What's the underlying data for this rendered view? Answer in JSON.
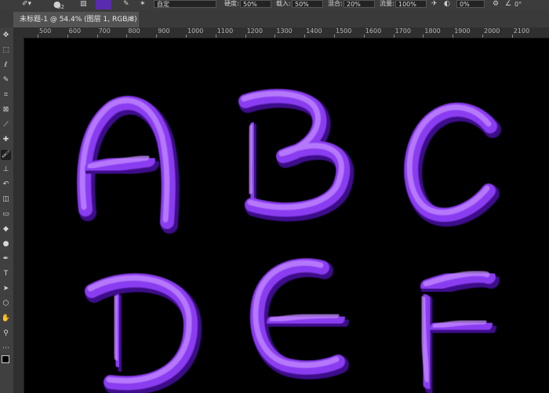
{
  "options_bar": {
    "brush_size": "92",
    "preset": "自定",
    "hardness_label": "硬度:",
    "hardness_value": "50%",
    "opacity_label": "载入:",
    "opacity_value": "50%",
    "mix_label": "混合:",
    "mix_value": "20%",
    "flow_label": "流量:",
    "flow_value": "100%",
    "angle_value": "0%",
    "angle2_value": "0°"
  },
  "document_tab": {
    "title": "未标题-1 @ 54.4% (图层 1, RGB/8) *",
    "close": "×"
  },
  "ruler": {
    "ticks": [
      "500",
      "600",
      "700",
      "800",
      "900",
      "1000",
      "1100",
      "1200",
      "1300",
      "1400",
      "1500",
      "1600",
      "1700",
      "1800",
      "1900",
      "2000",
      "2100"
    ]
  },
  "tools": [
    {
      "name": "move-tool-icon",
      "glyph": "✥"
    },
    {
      "name": "marquee-tool-icon",
      "glyph": "⬚"
    },
    {
      "name": "lasso-tool-icon",
      "glyph": "ℓ"
    },
    {
      "name": "quick-select-tool-icon",
      "glyph": "✎"
    },
    {
      "name": "crop-tool-icon",
      "glyph": "⌗"
    },
    {
      "name": "frame-tool-icon",
      "glyph": "⊠"
    },
    {
      "name": "eyedropper-tool-icon",
      "glyph": "⟋"
    },
    {
      "name": "healing-brush-tool-icon",
      "glyph": "✚"
    },
    {
      "name": "brush-tool-icon",
      "glyph": "🖌"
    },
    {
      "name": "clone-stamp-tool-icon",
      "glyph": "⊥"
    },
    {
      "name": "history-brush-tool-icon",
      "glyph": "↶"
    },
    {
      "name": "eraser-tool-icon",
      "glyph": "◫"
    },
    {
      "name": "gradient-tool-icon",
      "glyph": "▭"
    },
    {
      "name": "blur-tool-icon",
      "glyph": "◆"
    },
    {
      "name": "dodge-tool-icon",
      "glyph": "●"
    },
    {
      "name": "pen-tool-icon",
      "glyph": "✒"
    },
    {
      "name": "type-tool-icon",
      "glyph": "T"
    },
    {
      "name": "path-select-tool-icon",
      "glyph": "➤"
    },
    {
      "name": "shape-tool-icon",
      "glyph": "⬡"
    },
    {
      "name": "hand-tool-icon",
      "glyph": "✋"
    },
    {
      "name": "zoom-tool-icon",
      "glyph": "⚲"
    },
    {
      "name": "more-tools-icon",
      "glyph": "⋯"
    }
  ],
  "letters": [
    "A",
    "B",
    "C",
    "D",
    "E",
    "F"
  ],
  "colors": {
    "stroke_main": "#8a3cf0",
    "stroke_light": "#c58cff",
    "stroke_dark": "#3e0f8a",
    "canvas_bg": "#000000"
  }
}
